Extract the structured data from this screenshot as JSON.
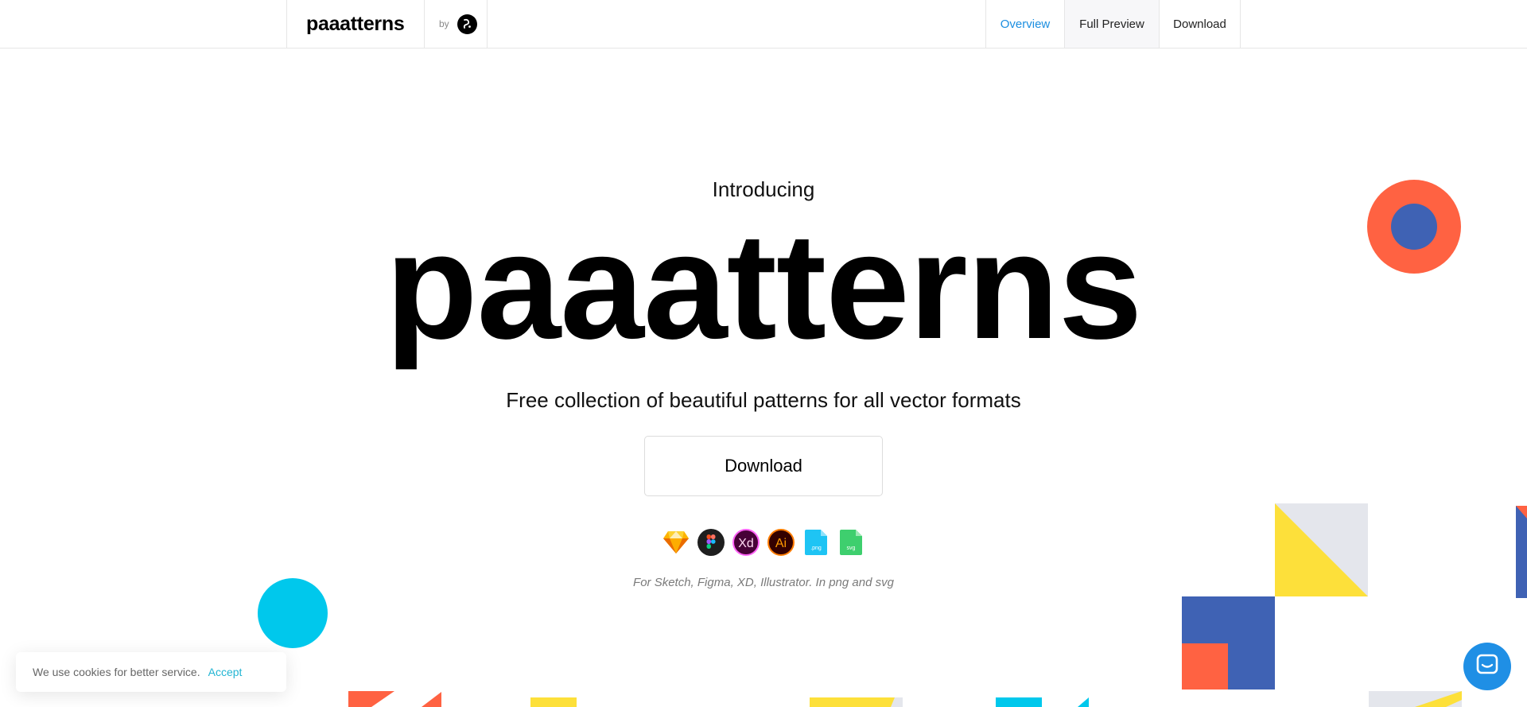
{
  "header": {
    "brand": "paaatterns",
    "by_label": "by",
    "nav": {
      "overview": "Overview",
      "full_preview": "Full Preview",
      "download": "Download"
    }
  },
  "hero": {
    "intro": "Introducing",
    "title": "paaatterns",
    "subtitle": "Free collection of beautiful patterns for all vector formats",
    "download_button": "Download",
    "formats": [
      {
        "icon": "sketch-icon"
      },
      {
        "icon": "figma-icon"
      },
      {
        "icon": "xd-icon",
        "label": "Xd"
      },
      {
        "icon": "illustrator-icon",
        "label": "Ai"
      },
      {
        "icon": "png-file-icon",
        "label": ".png"
      },
      {
        "icon": "svg-file-icon",
        "label": "svg"
      }
    ],
    "caption": "For Sketch, Figma, XD, Illustrator. In png and svg"
  },
  "cookie": {
    "message": "We use cookies for better service.",
    "accept": "Accept"
  },
  "chat": {
    "icon": "chat-icon"
  },
  "colors": {
    "accent_link": "#1b8ee0",
    "orange": "#ff6242",
    "blue": "#3f62b4",
    "cyan": "#00c8ec",
    "yellow": "#fde03a",
    "grey": "#e4e6ec",
    "chat_blue": "#1f8fe5"
  }
}
